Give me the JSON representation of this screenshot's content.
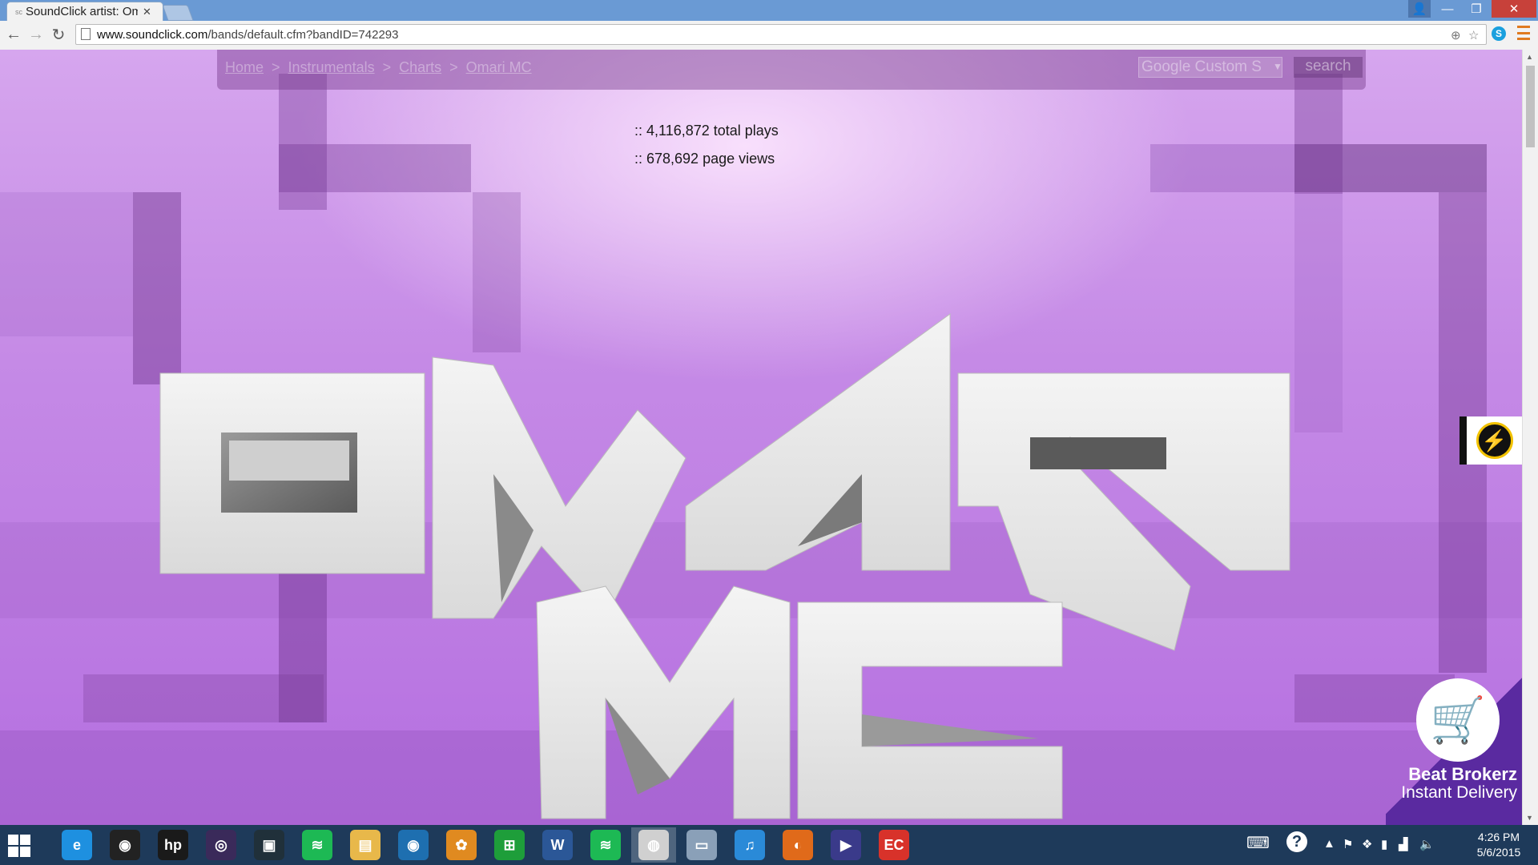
{
  "browser": {
    "tab_title": "SoundClick artist: Om",
    "favicon_text": "sc",
    "url_host": "www.soundclick.com",
    "url_path": "/bands/default.cfm?bandID=742293"
  },
  "site_nav": {
    "breadcrumbs": [
      "Home",
      "Instrumentals",
      "Charts",
      "Omari MC"
    ],
    "separator": ">",
    "search_placeholder": "Google Custom S",
    "search_button": "search"
  },
  "stats": {
    "plays": ":: 4,116,872 total plays",
    "views": ":: 678,692 page views"
  },
  "logo": {
    "line1": "OMARI",
    "line2": "MC"
  },
  "beat_widget": {
    "name": "Beat Brokerz",
    "subtitle": "Instant Delivery"
  },
  "taskbar": {
    "apps": [
      {
        "name": "internet-explorer",
        "color": "#1e90e0",
        "label": "e"
      },
      {
        "name": "webcam-app",
        "color": "#222222",
        "label": "◉"
      },
      {
        "name": "hp-app",
        "color": "#1a1a1a",
        "label": "hp"
      },
      {
        "name": "media-app",
        "color": "#3a2a5a",
        "label": "◎"
      },
      {
        "name": "video-app",
        "color": "#20303a",
        "label": "▣"
      },
      {
        "name": "spotify",
        "color": "#1db954",
        "label": "≋"
      },
      {
        "name": "file-explorer",
        "color": "#e8b84a",
        "label": "▤"
      },
      {
        "name": "disc-app",
        "color": "#1e6fb0",
        "label": "◉"
      },
      {
        "name": "fl-studio",
        "color": "#e08a20",
        "label": "✿"
      },
      {
        "name": "store",
        "color": "#1e9e3a",
        "label": "⊞"
      },
      {
        "name": "word",
        "color": "#2b5797",
        "label": "W"
      },
      {
        "name": "spotify-2",
        "color": "#1db954",
        "label": "≋"
      },
      {
        "name": "chrome",
        "color": "#d0d0d0",
        "label": "◍"
      },
      {
        "name": "monitor-app",
        "color": "#8aa0b8",
        "label": "▭"
      },
      {
        "name": "itunes",
        "color": "#2a8ad8",
        "label": "♫"
      },
      {
        "name": "firefox",
        "color": "#e06a1a",
        "label": "◐"
      },
      {
        "name": "camera-app",
        "color": "#3a3a8a",
        "label": "▶"
      },
      {
        "name": "acrobat",
        "color": "#d8322a",
        "label": "EC"
      }
    ],
    "time": "4:26 PM",
    "date": "5/6/2015"
  }
}
